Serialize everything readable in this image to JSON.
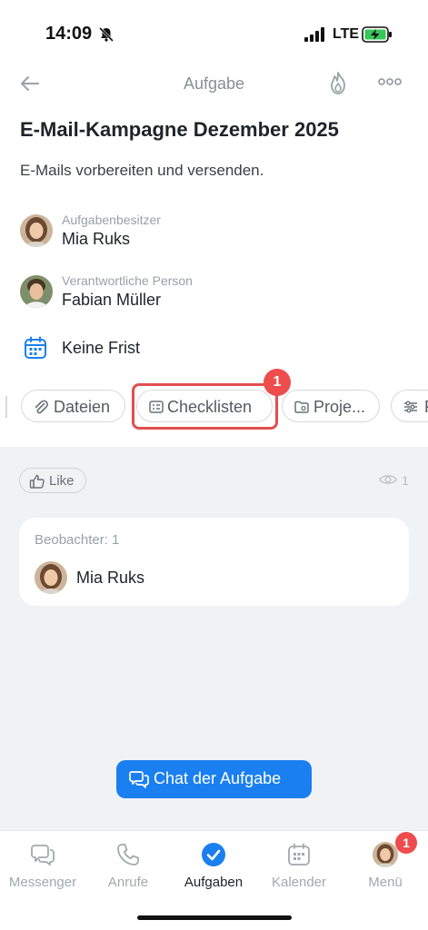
{
  "status": {
    "time": "14:09",
    "network": "LTE"
  },
  "nav": {
    "title": "Aufgabe"
  },
  "task": {
    "title": "E-Mail-Kampagne Dezember 2025",
    "description": "E-Mails vorbereiten und versenden.",
    "owner": {
      "role": "Aufgabenbesitzer",
      "name": "Mia Ruks"
    },
    "responsible": {
      "role": "Verantwortliche Person",
      "name": "Fabian Müller"
    },
    "deadline": "Keine Frist"
  },
  "chips": {
    "files": "Dateien",
    "checklists": "Checklisten",
    "project": "Proje...",
    "more": "F"
  },
  "step_badge": "1",
  "like": {
    "label": "Like"
  },
  "views": {
    "count": "1"
  },
  "observers": {
    "heading": "Beobachter: 1",
    "name": "Mia Ruks"
  },
  "chat_button": "Chat der Aufgabe",
  "tabbar": {
    "messenger": "Messenger",
    "calls": "Anrufe",
    "tasks": "Aufgaben",
    "calendar": "Kalender",
    "menu": "Menü",
    "menu_badge": "1"
  },
  "colors": {
    "accent": "#1a7ff0",
    "highlight": "#e0504f",
    "badge": "#ee4d4d"
  }
}
